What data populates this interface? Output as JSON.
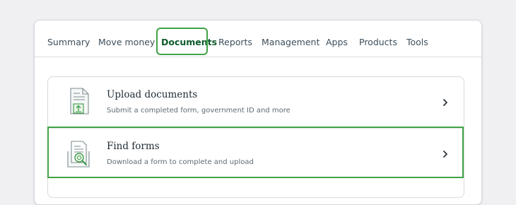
{
  "nav": {
    "tabs": [
      {
        "label": "Summary"
      },
      {
        "label": "Move money"
      },
      {
        "label": "Documents",
        "active": true
      },
      {
        "label": "Reports"
      },
      {
        "label": "Management"
      },
      {
        "label": "Apps"
      },
      {
        "label": "Products"
      },
      {
        "label": "Tools"
      }
    ]
  },
  "documents": {
    "items": [
      {
        "title": "Upload documents",
        "description": "Submit a completed form, government ID and more",
        "icon": "upload-document-icon"
      },
      {
        "title": "Find forms",
        "description": "Download a form to complete and upload",
        "icon": "find-forms-icon"
      }
    ]
  },
  "colors": {
    "accent": "#41a347",
    "active_tab_text": "#0d5a2a",
    "tab_text": "#3d4f5c",
    "page_bg": "#f0f0f3"
  }
}
